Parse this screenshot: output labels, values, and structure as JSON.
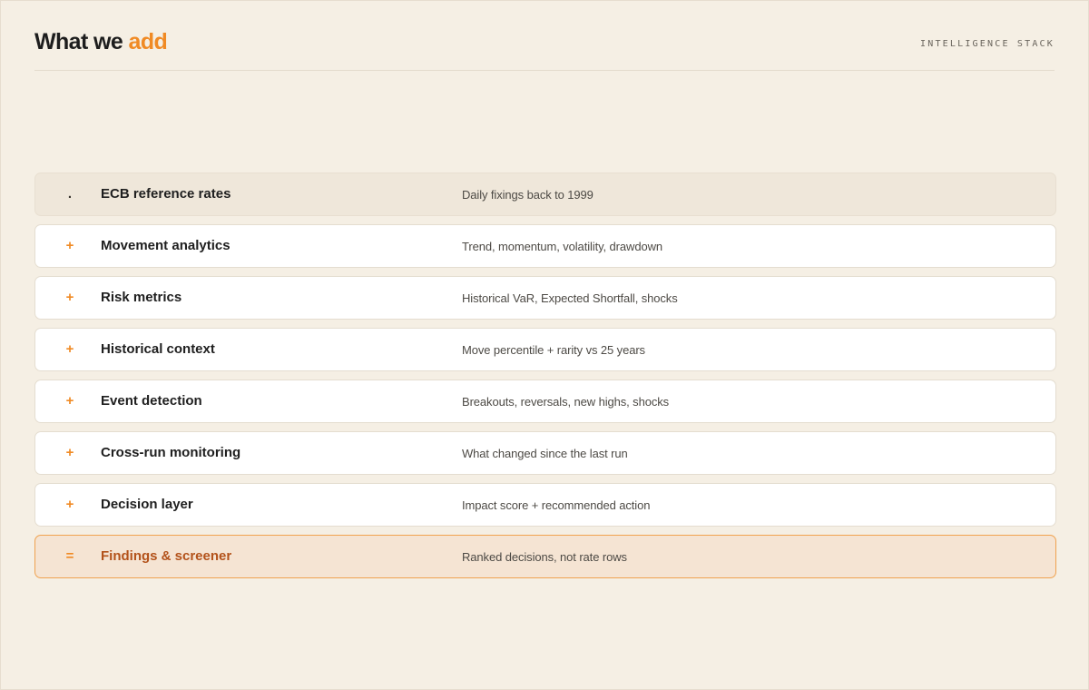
{
  "header": {
    "title_prefix": "What we ",
    "title_accent": "add",
    "eyebrow": "INTELLIGENCE STACK"
  },
  "colors": {
    "accent": "#f08a24",
    "background": "#f5efe4",
    "result_text": "#b3521a"
  },
  "stack": [
    {
      "marker": ".",
      "name": "ECB reference rates",
      "description": "Daily fixings back to 1999",
      "kind": "base"
    },
    {
      "marker": "+",
      "name": "Movement analytics",
      "description": "Trend, momentum, volatility, drawdown",
      "kind": "add"
    },
    {
      "marker": "+",
      "name": "Risk metrics",
      "description": "Historical VaR, Expected Shortfall, shocks",
      "kind": "add"
    },
    {
      "marker": "+",
      "name": "Historical context",
      "description": "Move percentile + rarity vs 25 years",
      "kind": "add"
    },
    {
      "marker": "+",
      "name": "Event detection",
      "description": "Breakouts, reversals, new highs, shocks",
      "kind": "add"
    },
    {
      "marker": "+",
      "name": "Cross-run monitoring",
      "description": "What changed since the last run",
      "kind": "add"
    },
    {
      "marker": "+",
      "name": "Decision layer",
      "description": "Impact score + recommended action",
      "kind": "add"
    },
    {
      "marker": "=",
      "name": "Findings & screener",
      "description": "Ranked decisions, not rate rows",
      "kind": "result"
    }
  ]
}
